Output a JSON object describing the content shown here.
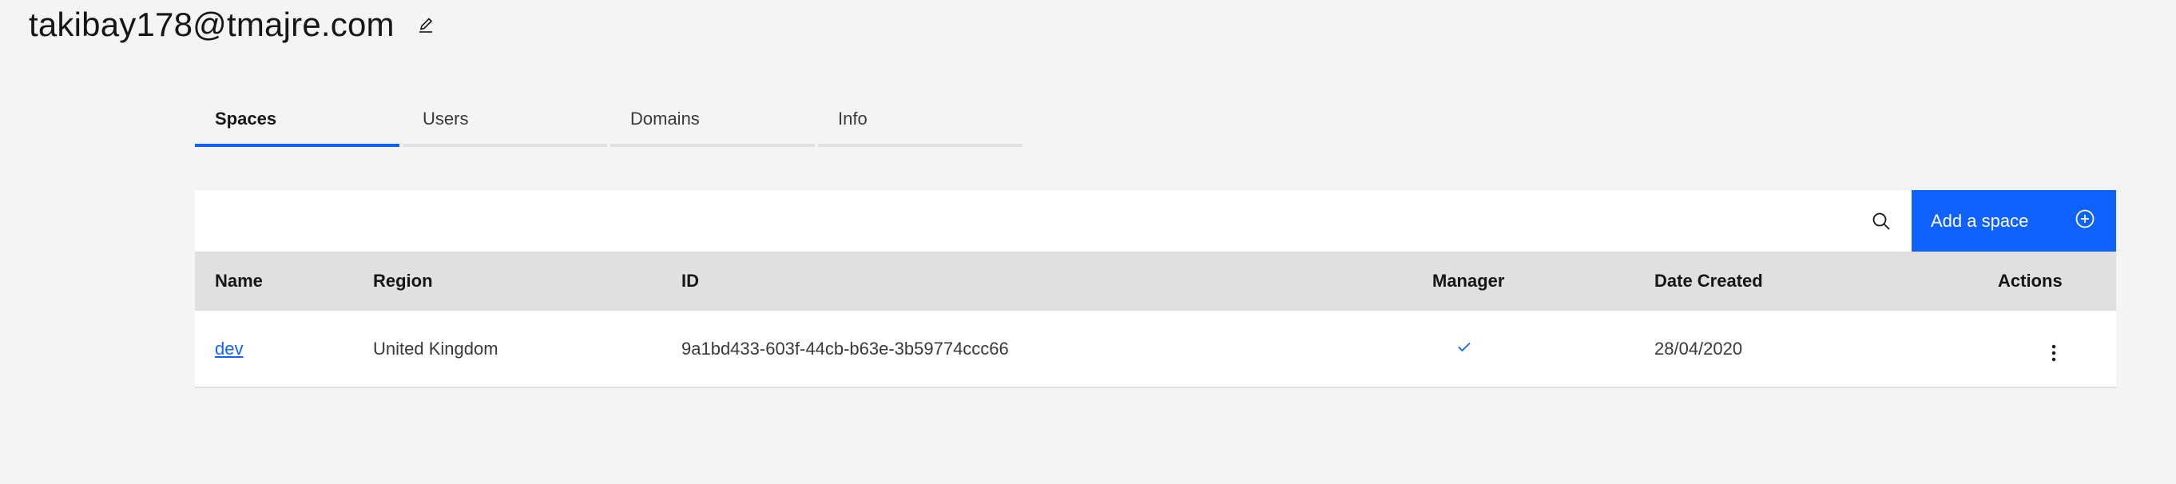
{
  "header": {
    "title": "takibay178@tmajre.com",
    "edit_icon": "edit-icon"
  },
  "tabs": [
    {
      "label": "Spaces",
      "active": true
    },
    {
      "label": "Users",
      "active": false
    },
    {
      "label": "Domains",
      "active": false
    },
    {
      "label": "Info",
      "active": false
    }
  ],
  "toolbar": {
    "search_icon": "search-icon",
    "add_label": "Add a space",
    "add_icon": "add-circle-icon"
  },
  "table": {
    "columns": [
      "Name",
      "Region",
      "ID",
      "Manager",
      "Date Created",
      "Actions"
    ],
    "rows": [
      {
        "name": "dev",
        "region": "United Kingdom",
        "id": "9a1bd433-603f-44cb-b63e-3b59774ccc66",
        "manager": true,
        "date_created": "28/04/2020",
        "actions_icon": "overflow-menu-icon"
      }
    ]
  },
  "colors": {
    "background": "#f4f4f4",
    "accent": "#0f62fe",
    "header_row": "#e0e0e0",
    "surface": "#ffffff"
  }
}
